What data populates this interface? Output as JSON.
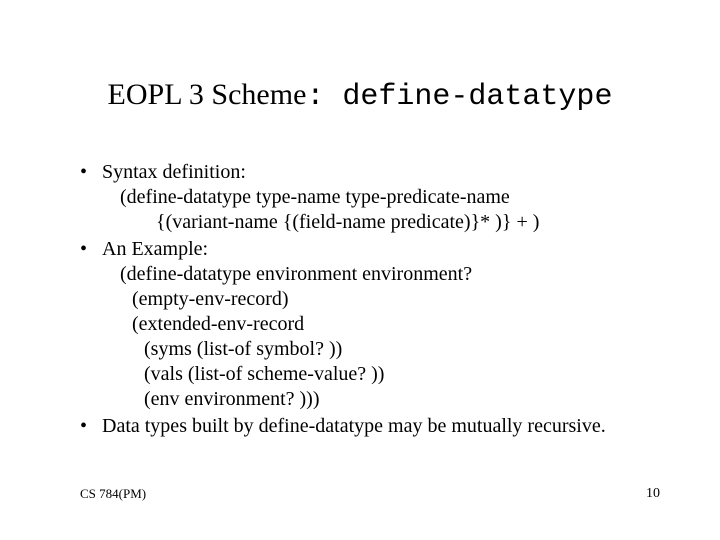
{
  "title": {
    "prefix": "EOPL 3 Scheme",
    "mono": ": define-datatype"
  },
  "bullets": [
    {
      "label": "Syntax definition:",
      "lines": [
        {
          "text": "(define-datatype type-name   type-predicate-name",
          "cls": "ind1"
        },
        {
          "text": "{(variant-name   {(field-name  predicate)}* )} + )",
          "cls": "ind2"
        }
      ]
    },
    {
      "label": "An Example:",
      "lines": [
        {
          "text": "(define-datatype environment environment?",
          "cls": "ind1"
        },
        {
          "text": "(empty-env-record)",
          "cls": "ind3"
        },
        {
          "text": "(extended-env-record",
          "cls": "ind3"
        },
        {
          "text": "(syms (list-of symbol? ))",
          "cls": "ind4"
        },
        {
          "text": "(vals (list-of scheme-value? ))",
          "cls": "ind4"
        },
        {
          "text": "(env environment? )))",
          "cls": "ind4"
        }
      ]
    },
    {
      "label": "Data types built by define-datatype may be mutually recursive.",
      "lines": []
    }
  ],
  "footer": {
    "left": "CS 784(PM)",
    "right": "10"
  }
}
